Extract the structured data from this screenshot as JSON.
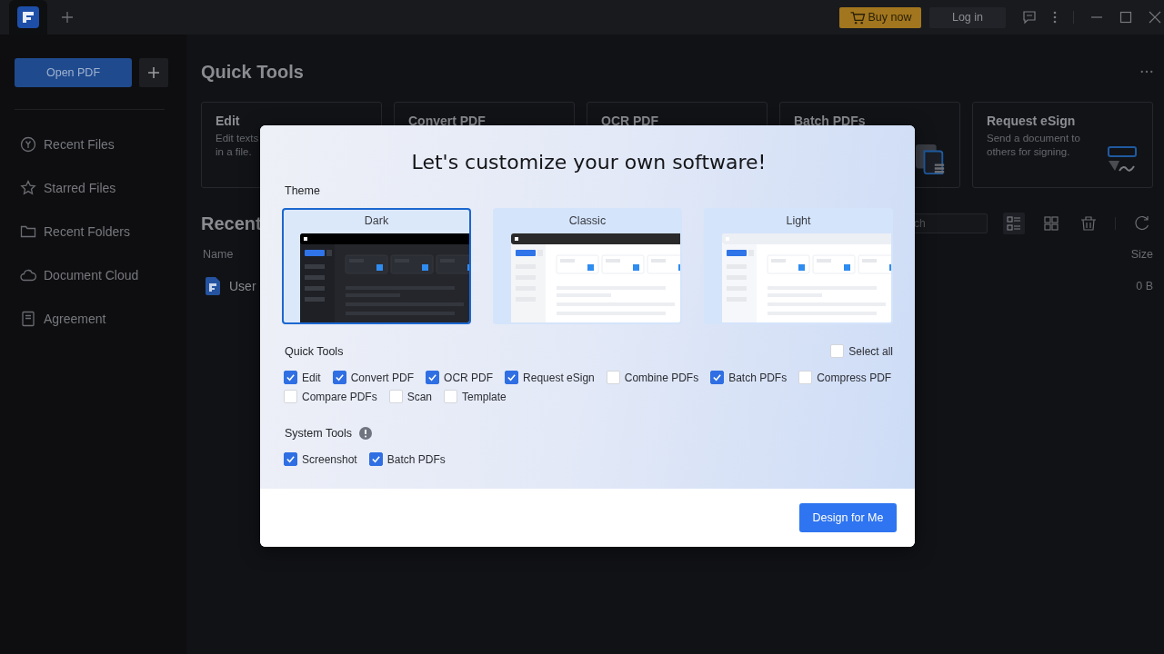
{
  "titlebar": {
    "buy_button": "Buy now",
    "login_button": "Log in"
  },
  "sidebar": {
    "open_button": "Open PDF",
    "items": [
      {
        "label": "Recent Files"
      },
      {
        "label": "Starred Files"
      },
      {
        "label": "Recent Folders"
      },
      {
        "label": "Document Cloud"
      },
      {
        "label": "Agreement"
      }
    ]
  },
  "main": {
    "title": "Quick Tools",
    "tool_cards": [
      {
        "title": "Edit",
        "description": [
          "Edit texts",
          "in a file."
        ]
      },
      {
        "title": "Convert PDF"
      },
      {
        "title": "OCR PDF"
      },
      {
        "title": "Batch PDFs"
      },
      {
        "title": "Request eSign",
        "description": [
          "Send a document to",
          "others for signing."
        ]
      }
    ],
    "recent": {
      "title": "Recent",
      "search": {
        "placeholder": "ch"
      },
      "columns": [
        "Name",
        "Size"
      ],
      "rows": [
        {
          "name": "User",
          "size": "0 B"
        }
      ]
    }
  },
  "dialog": {
    "title": "Let's customize your own software!",
    "theme": {
      "label": "Theme",
      "options": [
        {
          "label": "Dark",
          "kind": "dark",
          "selected": true
        },
        {
          "label": "Classic",
          "kind": "classic",
          "selected": false
        },
        {
          "label": "Light",
          "kind": "light",
          "selected": false
        }
      ]
    },
    "quick_tools": {
      "label": "Quick Tools",
      "select_all": {
        "label": "Select all",
        "checked": false
      },
      "items": [
        {
          "label": "Edit",
          "checked": true
        },
        {
          "label": "Convert PDF",
          "checked": true
        },
        {
          "label": "OCR PDF",
          "checked": true
        },
        {
          "label": "Request eSign",
          "checked": true
        },
        {
          "label": "Combine PDFs",
          "checked": false
        },
        {
          "label": "Batch PDFs",
          "checked": true
        },
        {
          "label": "Compress PDF",
          "checked": false
        },
        {
          "label": "Compare PDFs",
          "checked": false
        },
        {
          "label": "Scan",
          "checked": false
        },
        {
          "label": "Template",
          "checked": false
        }
      ]
    },
    "system_tools": {
      "label": "System Tools",
      "items": [
        {
          "label": "Screenshot",
          "checked": true
        },
        {
          "label": "Batch PDFs",
          "checked": true
        }
      ]
    },
    "button": "Design for Me"
  }
}
